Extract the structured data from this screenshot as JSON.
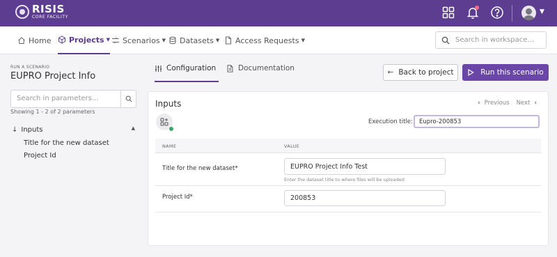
{
  "header": {
    "logo_title": "RISIS",
    "logo_subtitle": "CORE FACILITY",
    "icons": [
      "apps-grid-icon",
      "bell-icon",
      "help-icon",
      "user-avatar"
    ],
    "accent_color": "#5c3d8f"
  },
  "nav": {
    "items": [
      {
        "label": "Home",
        "icon": "home-icon",
        "active": false
      },
      {
        "label": "Projects",
        "icon": "cube-icon",
        "active": true,
        "dropdown": true
      },
      {
        "label": "Scenarios",
        "icon": "shuffle-icon",
        "active": false,
        "dropdown": true
      },
      {
        "label": "Datasets",
        "icon": "database-icon",
        "active": false,
        "dropdown": true
      },
      {
        "label": "Access Requests",
        "icon": "document-icon",
        "active": false,
        "dropdown": true
      }
    ],
    "search_placeholder": "Search in workspace..."
  },
  "sidebar": {
    "run_label": "RUN A SCENARIO",
    "project_title": "EUPRO Project Info",
    "param_search_placeholder": "Search in parameters...",
    "showing_text": "Showing 1 - 2 of 2 parameters",
    "group_label": "Inputs",
    "items": [
      "Title for the new dataset",
      "Project Id"
    ]
  },
  "tabs": [
    {
      "label": "Configuration",
      "icon": "sliders-icon",
      "active": true
    },
    {
      "label": "Documentation",
      "icon": "document-icon",
      "active": false
    }
  ],
  "actions": {
    "back_label": "Back to project",
    "run_label": "Run this scenario",
    "run_color": "#6a47a6"
  },
  "card": {
    "title": "Inputs",
    "previous_label": "Previous",
    "next_label": "Next",
    "execution_title_label": "Execution title:",
    "execution_title_value": "Eupro-200853",
    "status_color": "#3aa669",
    "table": {
      "headers": [
        "NAME",
        "VALUE"
      ],
      "rows": [
        {
          "name": "Title for the new dataset*",
          "value": "EUPRO Project Info Test",
          "help": "Enter the dataset title to where files will be uploaded"
        },
        {
          "name": "Project Id*",
          "value": "200853",
          "help": ""
        }
      ]
    }
  }
}
